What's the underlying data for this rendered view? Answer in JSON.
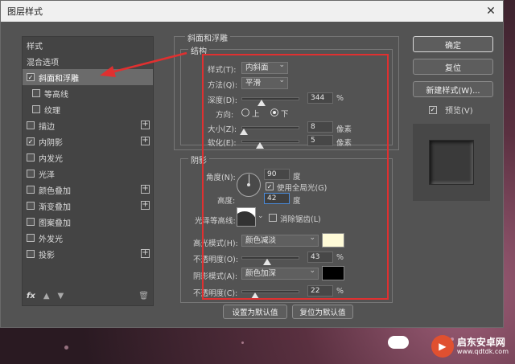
{
  "window": {
    "title": "图层样式"
  },
  "left_panel": {
    "items": [
      {
        "label": "样式",
        "checkbox": false,
        "plus": false,
        "checked": false,
        "selected": false,
        "sub": false
      },
      {
        "label": "混合选项",
        "checkbox": false,
        "plus": false,
        "checked": false,
        "selected": false,
        "sub": false
      },
      {
        "label": "斜面和浮雕",
        "checkbox": true,
        "plus": false,
        "checked": true,
        "selected": true,
        "sub": false
      },
      {
        "label": "等高线",
        "checkbox": true,
        "plus": false,
        "checked": false,
        "selected": false,
        "sub": true
      },
      {
        "label": "纹理",
        "checkbox": true,
        "plus": false,
        "checked": false,
        "selected": false,
        "sub": true
      },
      {
        "label": "描边",
        "checkbox": true,
        "plus": true,
        "checked": false,
        "selected": false,
        "sub": false
      },
      {
        "label": "内阴影",
        "checkbox": true,
        "plus": true,
        "checked": true,
        "selected": false,
        "sub": false
      },
      {
        "label": "内发光",
        "checkbox": true,
        "plus": false,
        "checked": false,
        "selected": false,
        "sub": false
      },
      {
        "label": "光泽",
        "checkbox": true,
        "plus": false,
        "checked": false,
        "selected": false,
        "sub": false
      },
      {
        "label": "颜色叠加",
        "checkbox": true,
        "plus": true,
        "checked": false,
        "selected": false,
        "sub": false
      },
      {
        "label": "渐变叠加",
        "checkbox": true,
        "plus": true,
        "checked": false,
        "selected": false,
        "sub": false
      },
      {
        "label": "图案叠加",
        "checkbox": true,
        "plus": false,
        "checked": false,
        "selected": false,
        "sub": false
      },
      {
        "label": "外发光",
        "checkbox": true,
        "plus": false,
        "checked": false,
        "selected": false,
        "sub": false
      },
      {
        "label": "投影",
        "checkbox": true,
        "plus": true,
        "checked": false,
        "selected": false,
        "sub": false
      }
    ],
    "footer_fx": "fx"
  },
  "bevel": {
    "section_title": "斜面和浮雕",
    "structure_title": "结构",
    "style_label": "样式(T):",
    "style_value": "内斜面",
    "technique_label": "方法(Q):",
    "technique_value": "平滑",
    "depth_label": "深度(D):",
    "depth_value": "344",
    "depth_unit": "%",
    "depth_level": 0.34,
    "direction_label": "方向:",
    "direction_up": "上",
    "direction_down": "下",
    "size_label": "大小(Z):",
    "size_value": "8",
    "size_unit": "像素",
    "size_level": 0.03,
    "soften_label": "软化(E):",
    "soften_value": "5",
    "soften_unit": "像素",
    "soften_level": 0.3
  },
  "shading": {
    "title": "阴影",
    "angle_label": "角度(N):",
    "angle_value": "90",
    "angle_unit": "度",
    "global_light_label": "使用全局光(G)",
    "altitude_label": "高度:",
    "altitude_value": "42",
    "altitude_unit": "度",
    "gloss_label": "光泽等高线:",
    "antialias_label": "消除锯齿(L)",
    "highlight_label": "高光模式(H):",
    "highlight_mode": "颜色减淡",
    "highlight_color": "#fffbd8",
    "highlight_opacity_label": "不透明度(O):",
    "highlight_opacity": "43",
    "highlight_opacity_level": 0.43,
    "shadow_label": "阴影模式(A):",
    "shadow_mode": "颜色加深",
    "shadow_color": "#000000",
    "shadow_opacity_label": "不透明度(C):",
    "shadow_opacity": "22",
    "shadow_opacity_level": 0.22,
    "percent": "%"
  },
  "bottom": {
    "set_default": "设置为默认值",
    "reset_default": "复位为默认值"
  },
  "right_panel": {
    "ok": "确定",
    "reset": "复位",
    "new_style": "新建样式(W)...",
    "preview_label": "预览(V)"
  },
  "watermark": {
    "brand": "启东安卓网",
    "url": "www.qdtdk.com"
  }
}
